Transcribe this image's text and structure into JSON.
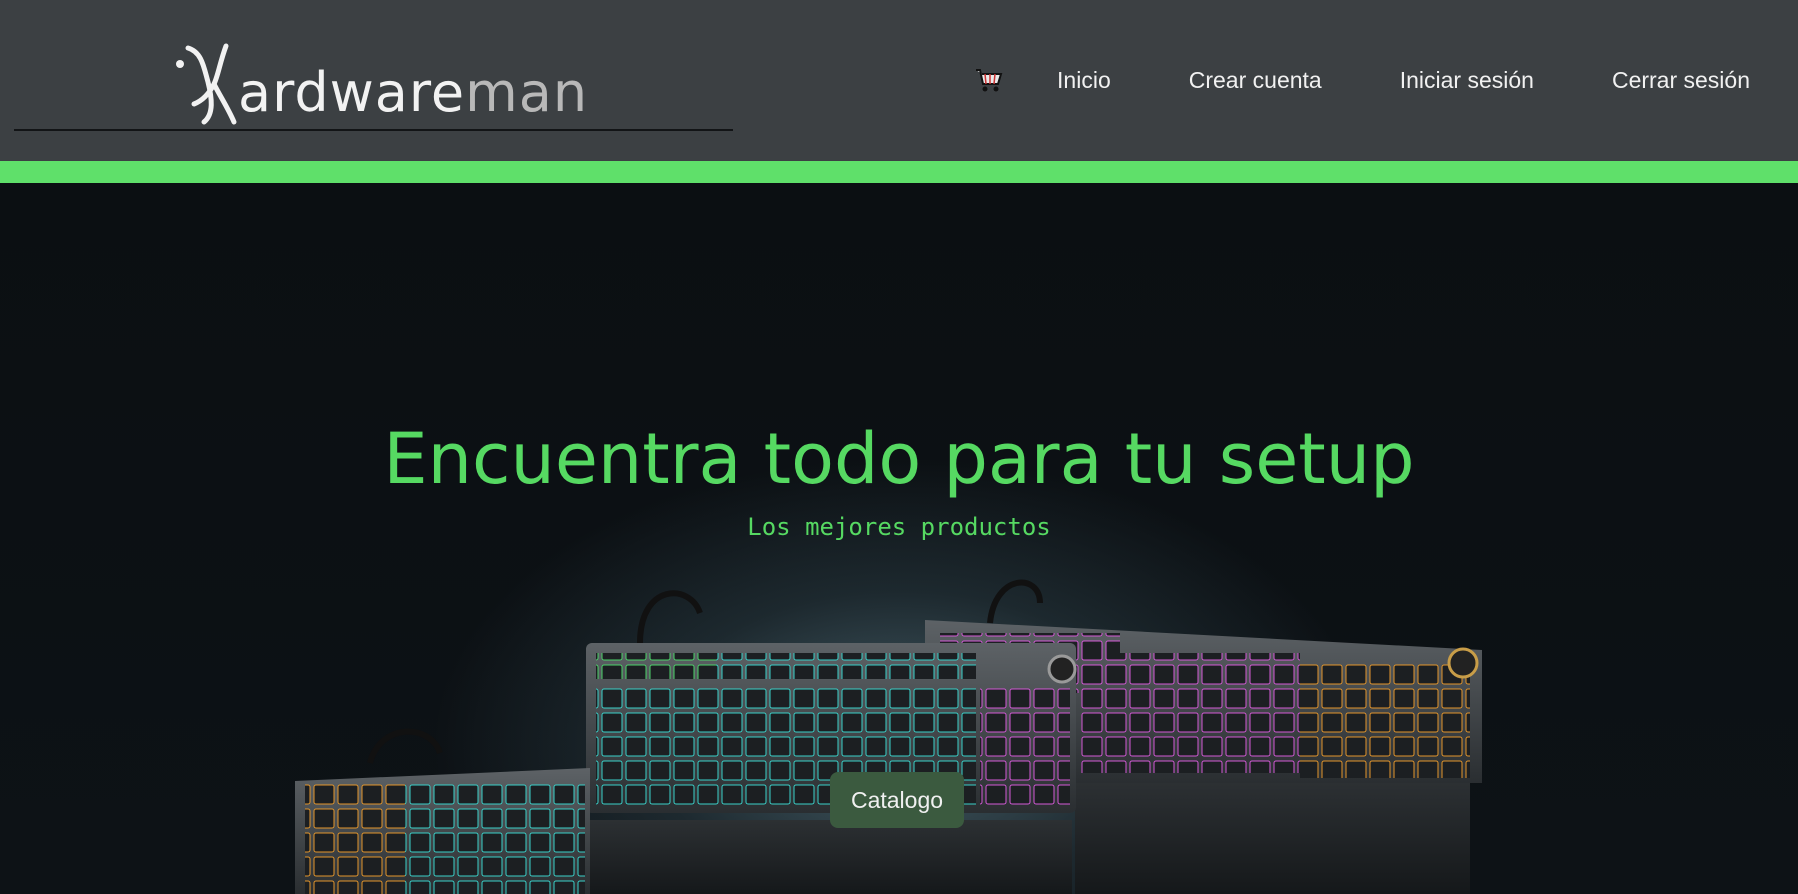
{
  "header": {
    "logo": {
      "text_main": "ardware",
      "text_tail": "man"
    },
    "nav": {
      "cart_icon": "shopping-cart-icon",
      "items": [
        "Inicio",
        "Crear cuenta",
        "Iniciar sesión",
        "Cerrar sesión"
      ]
    },
    "colors": {
      "header_bg": "#3c4043",
      "accent_bar": "#5fe06a"
    }
  },
  "hero": {
    "title": "Encuentra todo para tu setup",
    "subtitle": "Los mejores productos",
    "button_label": "Catalogo",
    "colors": {
      "title": "#56d962",
      "button_bg": "#3b5a3f"
    }
  }
}
